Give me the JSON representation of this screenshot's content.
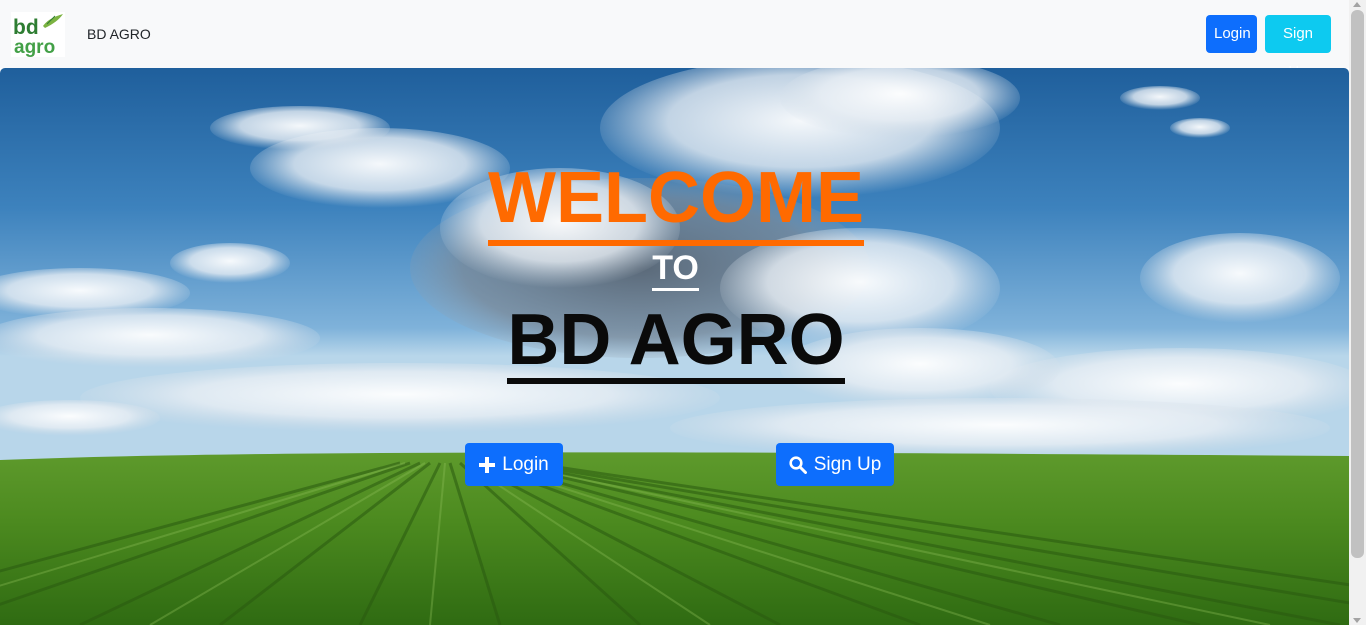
{
  "navbar": {
    "logo_text_top": "bd",
    "logo_text_bottom": "agro",
    "brand_name": "BD AGRO",
    "login_label": "Login",
    "signup_label": "Sign Up"
  },
  "hero": {
    "welcome": "WELCOME",
    "to": "TO",
    "brand": "BD AGRO",
    "login_button": {
      "label": "Login",
      "icon": "plus-icon"
    },
    "signup_button": {
      "label": "Sign Up",
      "icon": "search-icon"
    }
  },
  "colors": {
    "primary": "#0d6efd",
    "info": "#0dcaf0",
    "welcome": "#ff6a00",
    "navbar_bg": "#f8f9fa"
  }
}
